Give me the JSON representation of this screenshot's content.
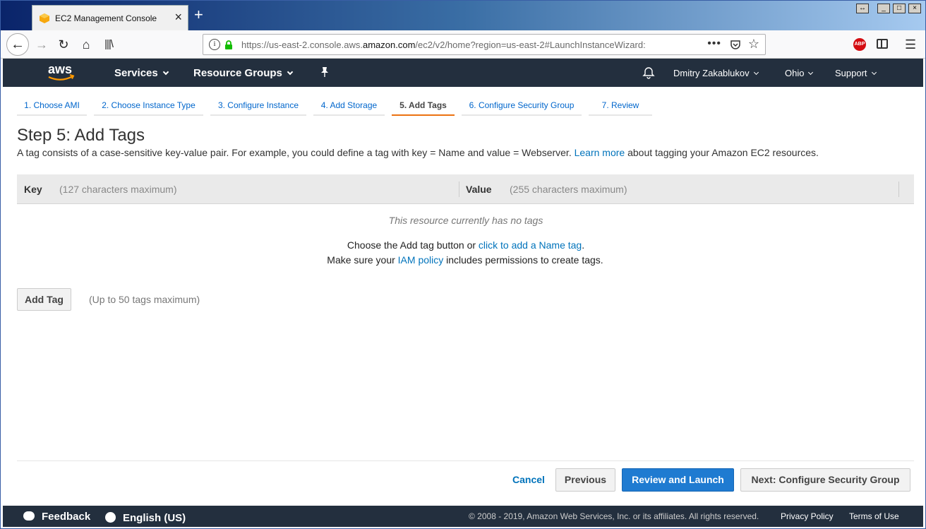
{
  "browser": {
    "tab_title": "EC2 Management Console",
    "url_prefix": "https://us-east-2.console.aws.",
    "url_domain": "amazon.com",
    "url_suffix": "/ec2/v2/home?region=us-east-2#LaunchInstanceWizard:",
    "url_more": "•••",
    "adblock_label": "ABP"
  },
  "aws_nav": {
    "services": "Services",
    "resource_groups": "Resource Groups",
    "user": "Dmitry Zakablukov",
    "region": "Ohio",
    "support": "Support",
    "brand_color": "#232f3e",
    "accent_color": "#ff9900"
  },
  "wizard_tabs": [
    {
      "label": "1. Choose AMI"
    },
    {
      "label": "2. Choose Instance Type"
    },
    {
      "label": "3. Configure Instance"
    },
    {
      "label": "4. Add Storage"
    },
    {
      "label": "5. Add Tags"
    },
    {
      "label": "6. Configure Security Group"
    },
    {
      "label": "7. Review"
    }
  ],
  "main": {
    "heading": "Step 5: Add Tags",
    "desc_text": "A tag consists of a case-sensitive key-value pair. For example, you could define a tag with key = Name and value = Webserver.",
    "desc_link": "Learn more",
    "desc_tail": "about tagging your Amazon EC2 resources.",
    "table": {
      "key_header": "Key",
      "key_hint": "(127 characters maximum)",
      "value_header": "Value",
      "value_hint": "(255 characters maximum)"
    },
    "no_tags": "This resource currently has no tags",
    "hint1_pre": "Choose the Add tag button or",
    "hint1_link": "click to add a Name tag",
    "hint1_post": ".",
    "hint2_pre": "Make sure your",
    "hint2_link": "IAM policy",
    "hint2_post": "includes permissions to create tags.",
    "add_tag_button": "Add Tag",
    "add_tag_note": "(Up to 50 tags maximum)"
  },
  "footer_buttons": {
    "cancel": "Cancel",
    "previous": "Previous",
    "review": "Review and Launch",
    "next": "Next: Configure Security Group"
  },
  "bottom_bar": {
    "feedback": "Feedback",
    "language": "English (US)",
    "copyright": "© 2008 - 2019, Amazon Web Services, Inc. or its affiliates. All rights reserved.",
    "privacy": "Privacy Policy",
    "terms": "Terms of Use"
  }
}
